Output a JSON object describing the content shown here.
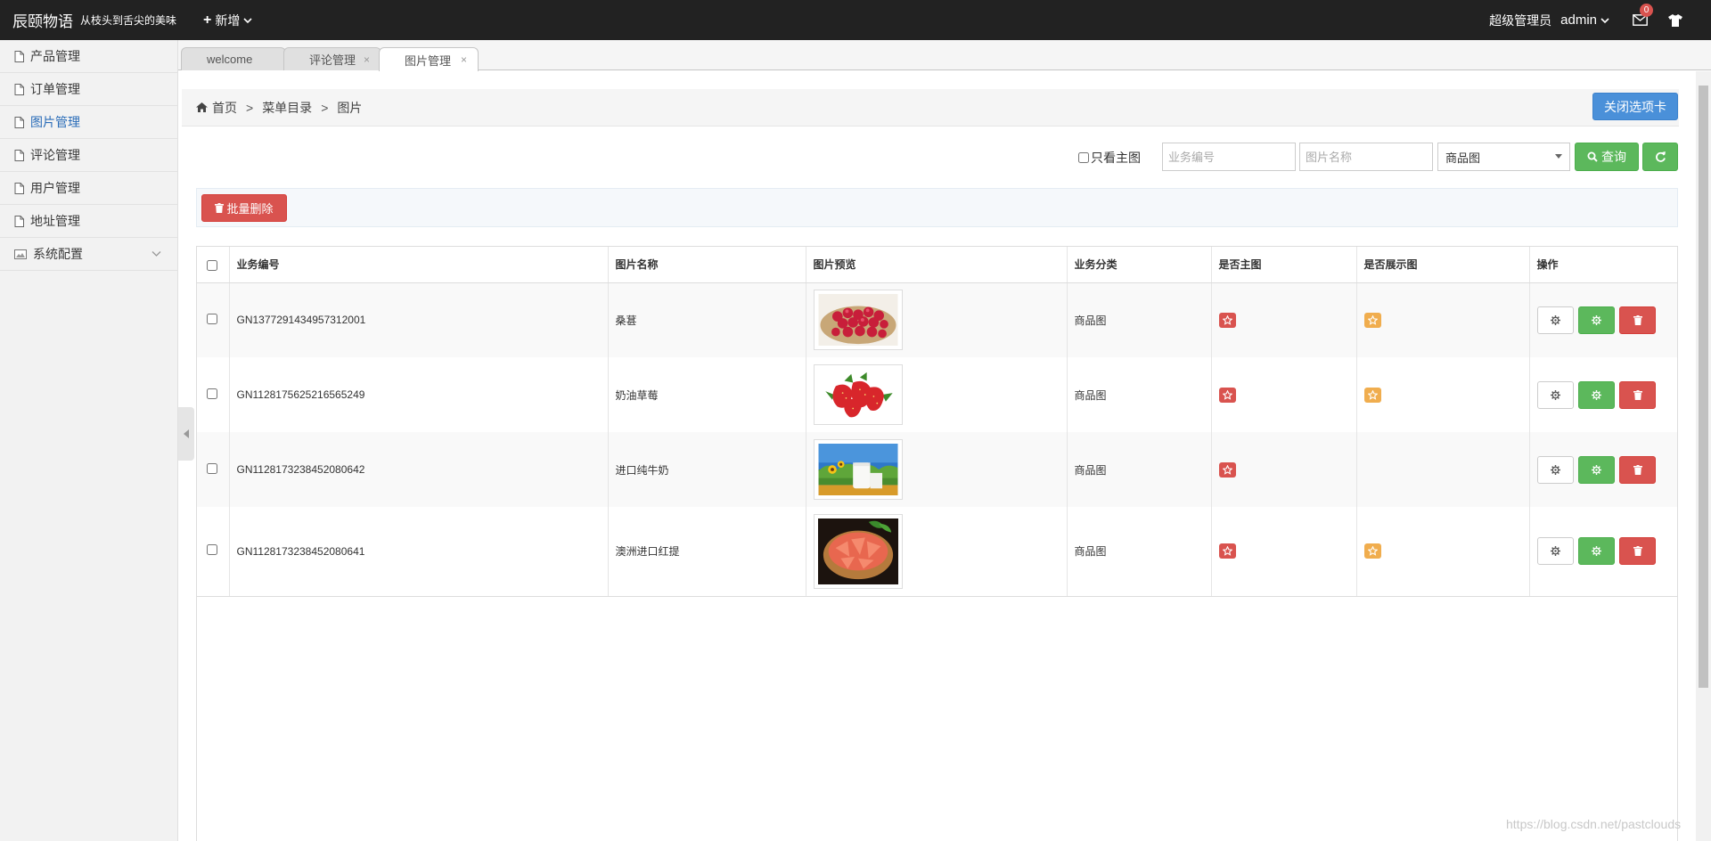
{
  "header": {
    "brand": "辰颐物语",
    "slogan": "从枝头到舌尖的美味",
    "add_new": "新增",
    "role": "超级管理员",
    "user": "admin",
    "mail_count": "0"
  },
  "sidebar": {
    "items": [
      {
        "label": "产品管理",
        "icon": "file-icon"
      },
      {
        "label": "订单管理",
        "icon": "file-icon"
      },
      {
        "label": "图片管理",
        "icon": "file-icon",
        "active": true
      },
      {
        "label": "评论管理",
        "icon": "file-icon"
      },
      {
        "label": "用户管理",
        "icon": "file-icon"
      },
      {
        "label": "地址管理",
        "icon": "file-icon"
      },
      {
        "label": "系统配置",
        "icon": "picture-icon",
        "expandable": true
      }
    ]
  },
  "tabs": [
    {
      "label": "welcome"
    },
    {
      "label": "评论管理",
      "close": "×"
    },
    {
      "label": "图片管理",
      "close": "×",
      "active": true
    }
  ],
  "breadcrumb": {
    "home": "首页",
    "sep": ">",
    "level1": "菜单目录",
    "level2": "图片"
  },
  "close_tabs_label": "关闭选项卡",
  "filters": {
    "main_only_label": "只看主图",
    "biz_no_placeholder": "业务编号",
    "image_name_placeholder": "图片名称",
    "category_selected": "商品图",
    "search_label": "查询"
  },
  "toolbar": {
    "batch_delete_label": "批量删除"
  },
  "table": {
    "headers": [
      "业务编号",
      "图片名称",
      "图片预览",
      "业务分类",
      "是否主图",
      "是否展示图",
      "操作"
    ],
    "rows": [
      {
        "biz_no": "GN1377291434957312001",
        "name": "桑葚",
        "category": "商品图",
        "is_main": true,
        "is_display": true,
        "preview": "raspberry-photo"
      },
      {
        "biz_no": "GN1128175625216565249",
        "name": "奶油草莓",
        "category": "商品图",
        "is_main": true,
        "is_display": true,
        "preview": "strawberry-photo"
      },
      {
        "biz_no": "GN1128173238452080642",
        "name": "进口纯牛奶",
        "category": "商品图",
        "is_main": true,
        "is_display": false,
        "preview": "milk-photo"
      },
      {
        "biz_no": "GN1128173238452080641",
        "name": "澳洲进口红提",
        "category": "商品图",
        "is_main": true,
        "is_display": true,
        "preview": "grapefruit-photo"
      }
    ]
  },
  "colors": {
    "header_bg": "#222222",
    "primary_blue": "#4a90d9",
    "success_green": "#5cb85c",
    "danger_red": "#d9534f",
    "warning_orange": "#f0ad4e",
    "active_link": "#2a6cb8"
  },
  "watermark": "https://blog.csdn.net/pastclouds"
}
